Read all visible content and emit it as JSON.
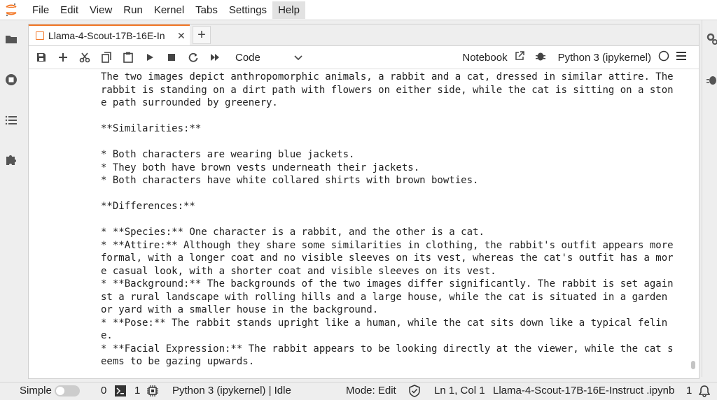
{
  "menubar": {
    "items": [
      "File",
      "Edit",
      "View",
      "Run",
      "Kernel",
      "Tabs",
      "Settings",
      "Help"
    ]
  },
  "tab": {
    "label": "Llama-4-Scout-17B-16E-In",
    "close": "✕"
  },
  "toolbar": {
    "cell_type": "Code",
    "notebook_label": "Notebook",
    "kernel_label": "Python 3 (ipykernel)"
  },
  "output": {
    "lines": [
      "The two images depict anthropomorphic animals, a rabbit and a cat, dressed in similar attire. The",
      "rabbit is standing on a dirt path with flowers on either side, while the cat is sitting on a ston",
      "e path surrounded by greenery.",
      "",
      "**Similarities:**",
      "",
      "* Both characters are wearing blue jackets.",
      "* They both have brown vests underneath their jackets.",
      "* Both characters have white collared shirts with brown bowties.",
      "",
      "**Differences:**",
      "",
      "* **Species:** One character is a rabbit, and the other is a cat.",
      "* **Attire:** Although they share some similarities in clothing, the rabbit's outfit appears more",
      "formal, with a longer coat and no visible sleeves on its vest, whereas the cat's outfit has a mor",
      "e casual look, with a shorter coat and visible sleeves on its vest.",
      "* **Background:** The backgrounds of the two images differ significantly. The rabbit is set again",
      "st a rural landscape with rolling hills and a large house, while the cat is situated in a garden",
      "or yard with a smaller house in the background.",
      "* **Pose:** The rabbit stands upright like a human, while the cat sits down like a typical felin",
      "e.",
      "* **Facial Expression:** The rabbit appears to be looking directly at the viewer, while the cat s",
      "eems to be gazing upwards."
    ]
  },
  "statusbar": {
    "mode_simple": "Simple",
    "terminals_count": "0",
    "kernels_count": "1",
    "kernel_status": "Python 3 (ipykernel) | Idle",
    "mode": "Mode: Edit",
    "position": "Ln 1, Col 1",
    "filename": "Llama-4-Scout-17B-16E-Instruct .ipynb",
    "notifications": "1"
  },
  "colors": {
    "accent": "#f37726",
    "background": "#eeeeee",
    "panel": "#ffffff"
  }
}
